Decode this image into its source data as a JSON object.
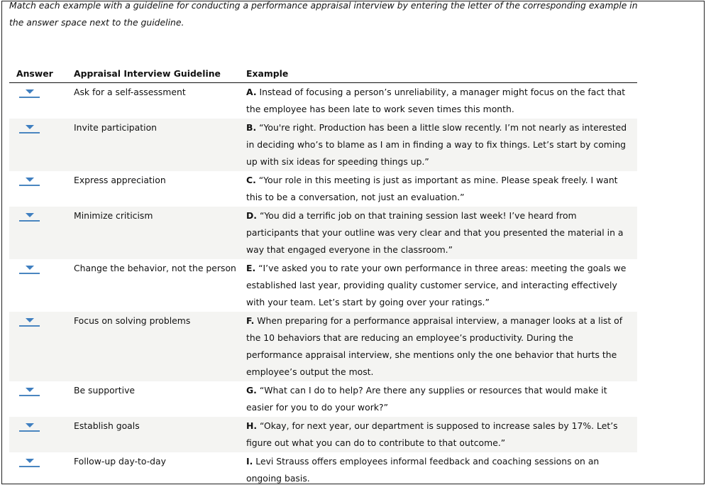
{
  "instructions": "Match each example with a guideline for conducting a performance appraisal interview by entering the letter of the corresponding example in the answer space next to the guideline.",
  "table": {
    "headers": {
      "answer": "Answer",
      "guideline": "Appraisal Interview Guideline",
      "example": "Example"
    },
    "rows": [
      {
        "answer": "",
        "guideline": "Ask for a self-assessment",
        "letter": "A.",
        "example": " Instead of focusing a person’s unreliability, a manager might focus on the fact that the employee has been late to work seven times this month."
      },
      {
        "answer": "",
        "guideline": "Invite participation",
        "letter": "B.",
        "example": " “You're right. Production has been a little slow recently. I’m not nearly as interested in deciding who’s to blame as I am in finding a way to fix things. Let’s start by coming up with six ideas for speeding things up.”"
      },
      {
        "answer": "",
        "guideline": "Express appreciation",
        "letter": "C.",
        "example": " “Your role in this meeting is just as important as mine. Please speak freely. I want this to be a conversation, not just an evaluation.”"
      },
      {
        "answer": "",
        "guideline": "Minimize criticism",
        "letter": "D.",
        "example": " “You did a terrific job on that training session last week! I’ve heard from participants that your outline was very clear and that you presented the material in a way that engaged everyone in the classroom.”"
      },
      {
        "answer": "",
        "guideline": "Change the behavior, not the person",
        "letter": "E.",
        "example": " “I’ve asked you to rate your own performance in three areas: meeting the goals we established last year, providing quality customer service, and interacting effectively with your team. Let’s start by going over your ratings.”"
      },
      {
        "answer": "",
        "guideline": "Focus on solving problems",
        "letter": "F.",
        "example": " When preparing for a performance appraisal interview, a manager looks at a list of the 10 behaviors that are reducing an employee’s productivity. During the performance appraisal interview, she mentions only the one behavior that hurts the employee’s output the most."
      },
      {
        "answer": "",
        "guideline": "Be supportive",
        "letter": "G.",
        "example": " “What can I do to help? Are there any supplies or resources that would make it easier for you to do your work?”"
      },
      {
        "answer": "",
        "guideline": "Establish goals",
        "letter": "H.",
        "example": " “Okay, for next year, our department is supposed to increase sales by 17%. Let’s figure out what you can do to contribute to that outcome.”"
      },
      {
        "answer": "",
        "guideline": "Follow-up day-to-day",
        "letter": "I.",
        "example": " Levi Strauss offers employees informal feedback and coaching sessions on an ongoing basis."
      }
    ]
  },
  "icons": {
    "answer_dropdown": "dropdown-arrow-icon"
  },
  "colors": {
    "accent": "#4a86c0",
    "row_alt": "#f4f4f2",
    "border": "#222222"
  }
}
